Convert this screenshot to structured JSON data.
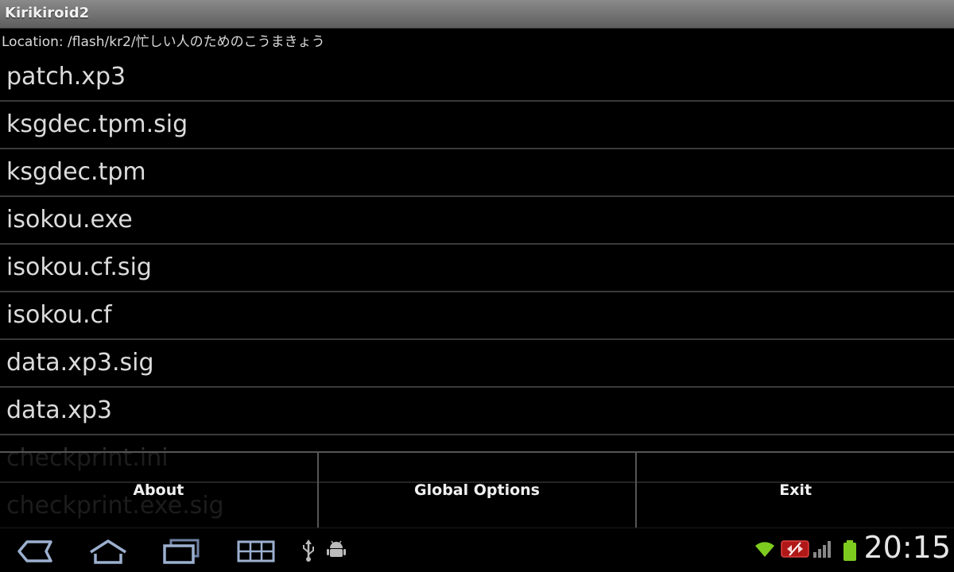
{
  "app": {
    "title": "Kirikiroid2"
  },
  "location": {
    "text": "Location: /flash/kr2/忙しい人のためのこうまきょう"
  },
  "files": [
    {
      "name": "patch.xp3"
    },
    {
      "name": "ksgdec.tpm.sig"
    },
    {
      "name": "ksgdec.tpm"
    },
    {
      "name": "isokou.exe"
    },
    {
      "name": "isokou.cf.sig"
    },
    {
      "name": "isokou.cf"
    },
    {
      "name": "data.xp3.sig"
    },
    {
      "name": "data.xp3"
    },
    {
      "name": "checkprint.ini"
    },
    {
      "name": "checkprint.exe.sig"
    }
  ],
  "menu": {
    "about_label": "About",
    "global_options_label": "Global Options",
    "exit_label": "Exit"
  },
  "system_bar": {
    "icons": [
      "back-icon",
      "home-icon",
      "recent-apps-icon",
      "menu-icon",
      "usb-icon",
      "android-debug-icon",
      "wifi-icon",
      "alert-icon",
      "signal-icon",
      "battery-icon"
    ],
    "time": "20:15",
    "accent_color": "#7ecb20"
  }
}
